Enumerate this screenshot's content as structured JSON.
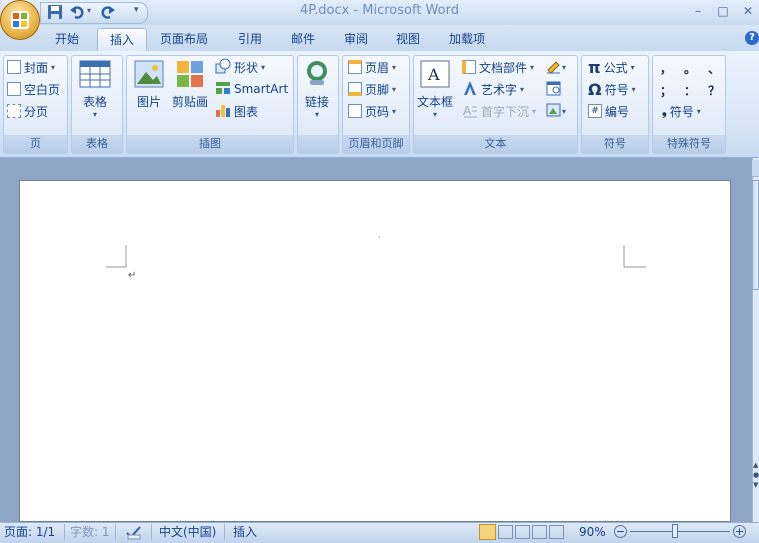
{
  "window": {
    "title": "4P.docx - Microsoft Word",
    "controls": {
      "minimize": "–",
      "maximize": "□",
      "close": "✕"
    }
  },
  "quick_access": {
    "customize_arrow": "▾"
  },
  "tabs": [
    {
      "label": "开始"
    },
    {
      "label": "插入",
      "active": true
    },
    {
      "label": "页面布局"
    },
    {
      "label": "引用"
    },
    {
      "label": "邮件"
    },
    {
      "label": "审阅"
    },
    {
      "label": "视图"
    },
    {
      "label": "加载项"
    }
  ],
  "help_glyph": "?",
  "ribbon": {
    "pages": {
      "label": "页",
      "cover": "封面",
      "blank_page": "空白页",
      "page_break": "分页"
    },
    "tables": {
      "label": "表格",
      "table": "表格"
    },
    "illustrations": {
      "label": "插图",
      "picture": "图片",
      "clipart": "剪贴画",
      "shapes": "形状",
      "smartart": "SmartArt",
      "chart": "图表"
    },
    "links": {
      "label": "",
      "link": "链接"
    },
    "header_footer": {
      "label": "页眉和页脚",
      "header": "页眉",
      "footer": "页脚",
      "page_number": "页码"
    },
    "text": {
      "label": "文本",
      "textbox": "文本框",
      "quick_parts": "文档部件",
      "wordart": "艺术字",
      "dropcap": "首字下沉"
    },
    "symbols": {
      "label": "符号",
      "equation": "公式",
      "symbol": "符号",
      "numbering": "编号"
    },
    "special": {
      "label": "特殊符号",
      "row1": [
        "，",
        "。",
        "、"
      ],
      "row2": [
        "；",
        "：",
        "？"
      ],
      "symbol": "符号"
    }
  },
  "document": {
    "paragraph_mark": "↵",
    "cursor_mark": "·"
  },
  "status": {
    "page": "页面: 1/1",
    "words": "字数: 1",
    "language": "中文(中国)",
    "mode": "插入",
    "zoom": "90%"
  },
  "colors": {
    "accent": "#15428b",
    "ribbon_bg": "#dce8f7",
    "page": "#ffffff"
  }
}
